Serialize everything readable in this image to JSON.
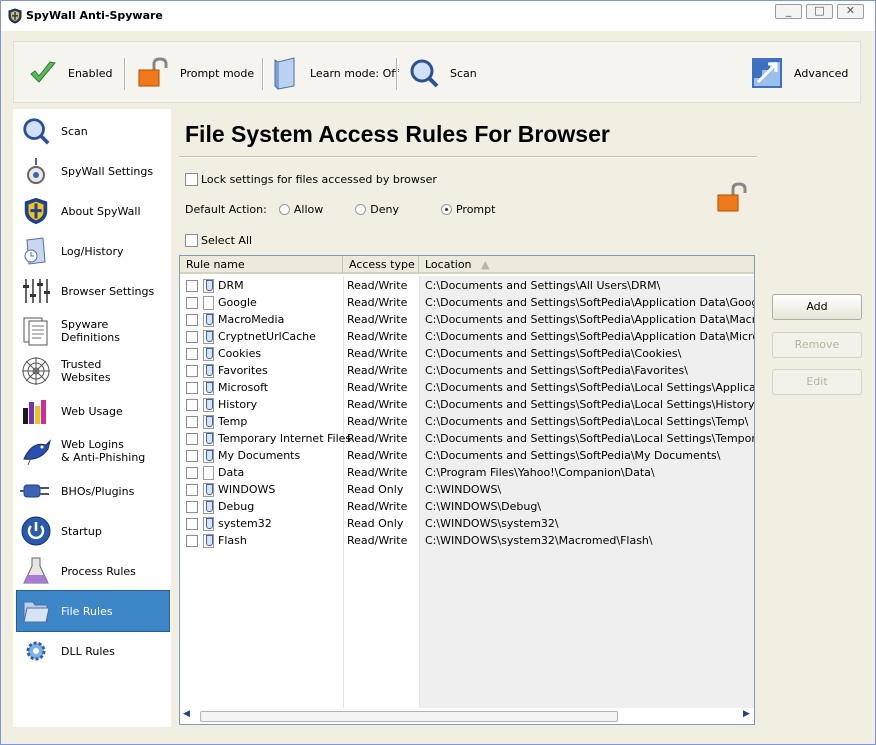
{
  "window": {
    "title": "SpyWall Anti-Spyware",
    "buttons": [
      "_",
      "□",
      "✕"
    ]
  },
  "toolbar": {
    "enabled_label": "Enabled",
    "prompt_mode_label": "Prompt mode",
    "learn_mode_label": "Learn mode: Off",
    "scan_label": "Scan",
    "advanced_label": "Advanced"
  },
  "sidebar": {
    "items": [
      {
        "label": "Scan",
        "icon": "magnifier-icon"
      },
      {
        "label": "SpyWall Settings",
        "icon": "settings-icon"
      },
      {
        "label": "About SpyWall",
        "icon": "shield-icon"
      },
      {
        "label": "Log/History",
        "icon": "log-icon"
      },
      {
        "label": "Browser Settings",
        "icon": "sliders-icon"
      },
      {
        "label": "Spyware\nDefinitions",
        "icon": "definitions-icon"
      },
      {
        "label": "Trusted\nWebsites",
        "icon": "web-icon"
      },
      {
        "label": "Web Usage",
        "icon": "bar-chart-icon"
      },
      {
        "label": "Web Logins\n& Anti-Phishing",
        "icon": "fish-icon"
      },
      {
        "label": "BHOs/Plugins",
        "icon": "plug-icon"
      },
      {
        "label": "Startup",
        "icon": "power-icon"
      },
      {
        "label": "Process Rules",
        "icon": "flask-icon"
      },
      {
        "label": "File Rules",
        "icon": "folder-icon"
      },
      {
        "label": "DLL Rules",
        "icon": "gear-icon"
      }
    ],
    "active_index": 12
  },
  "main": {
    "title": "File System Access Rules For Browser",
    "lock_settings_label": "Lock settings for files accessed by browser",
    "default_action_label": "Default Action:",
    "actions": [
      "Allow",
      "Deny",
      "Prompt"
    ],
    "selected_action": "Prompt",
    "select_all_label": "Select All",
    "columns": [
      "Rule name",
      "Access type",
      "Location"
    ],
    "rows": [
      {
        "name": "DRM",
        "access": "Read/Write",
        "location": "C:\\Documents and Settings\\All Users\\DRM\\",
        "icon": "blue"
      },
      {
        "name": "Google",
        "access": "Read/Write",
        "location": "C:\\Documents and Settings\\SoftPedia\\Application Data\\Google\\",
        "icon": "plain"
      },
      {
        "name": "MacroMedia",
        "access": "Read/Write",
        "location": "C:\\Documents and Settings\\SoftPedia\\Application Data\\MacroMedia\\",
        "icon": "blue"
      },
      {
        "name": "CryptnetUrlCache",
        "access": "Read/Write",
        "location": "C:\\Documents and Settings\\SoftPedia\\Application Data\\Microsoft\\Cryp",
        "icon": "blue"
      },
      {
        "name": "Cookies",
        "access": "Read/Write",
        "location": "C:\\Documents and Settings\\SoftPedia\\Cookies\\",
        "icon": "blue"
      },
      {
        "name": "Favorites",
        "access": "Read/Write",
        "location": "C:\\Documents and Settings\\SoftPedia\\Favorites\\",
        "icon": "blue"
      },
      {
        "name": "Microsoft",
        "access": "Read/Write",
        "location": "C:\\Documents and Settings\\SoftPedia\\Local Settings\\Application Data",
        "icon": "blue"
      },
      {
        "name": "History",
        "access": "Read/Write",
        "location": "C:\\Documents and Settings\\SoftPedia\\Local Settings\\History\\",
        "icon": "blue"
      },
      {
        "name": "Temp",
        "access": "Read/Write",
        "location": "C:\\Documents and Settings\\SoftPedia\\Local Settings\\Temp\\",
        "icon": "blue"
      },
      {
        "name": "Temporary Internet Files",
        "access": "Read/Write",
        "location": "C:\\Documents and Settings\\SoftPedia\\Local Settings\\Temporary Interi",
        "icon": "blue"
      },
      {
        "name": "My Documents",
        "access": "Read/Write",
        "location": "C:\\Documents and Settings\\SoftPedia\\My Documents\\",
        "icon": "blue"
      },
      {
        "name": "Data",
        "access": "Read/Write",
        "location": "C:\\Program Files\\Yahoo!\\Companion\\Data\\",
        "icon": "plain"
      },
      {
        "name": "WINDOWS",
        "access": "Read Only",
        "location": "C:\\WINDOWS\\",
        "icon": "blue"
      },
      {
        "name": "Debug",
        "access": "Read/Write",
        "location": "C:\\WINDOWS\\Debug\\",
        "icon": "blue"
      },
      {
        "name": "system32",
        "access": "Read Only",
        "location": "C:\\WINDOWS\\system32\\",
        "icon": "blue"
      },
      {
        "name": "Flash",
        "access": "Read/Write",
        "location": "C:\\WINDOWS\\system32\\Macromed\\Flash\\",
        "icon": "blue"
      }
    ]
  },
  "buttons": {
    "add": "Add",
    "remove": "Remove",
    "edit": "Edit"
  }
}
